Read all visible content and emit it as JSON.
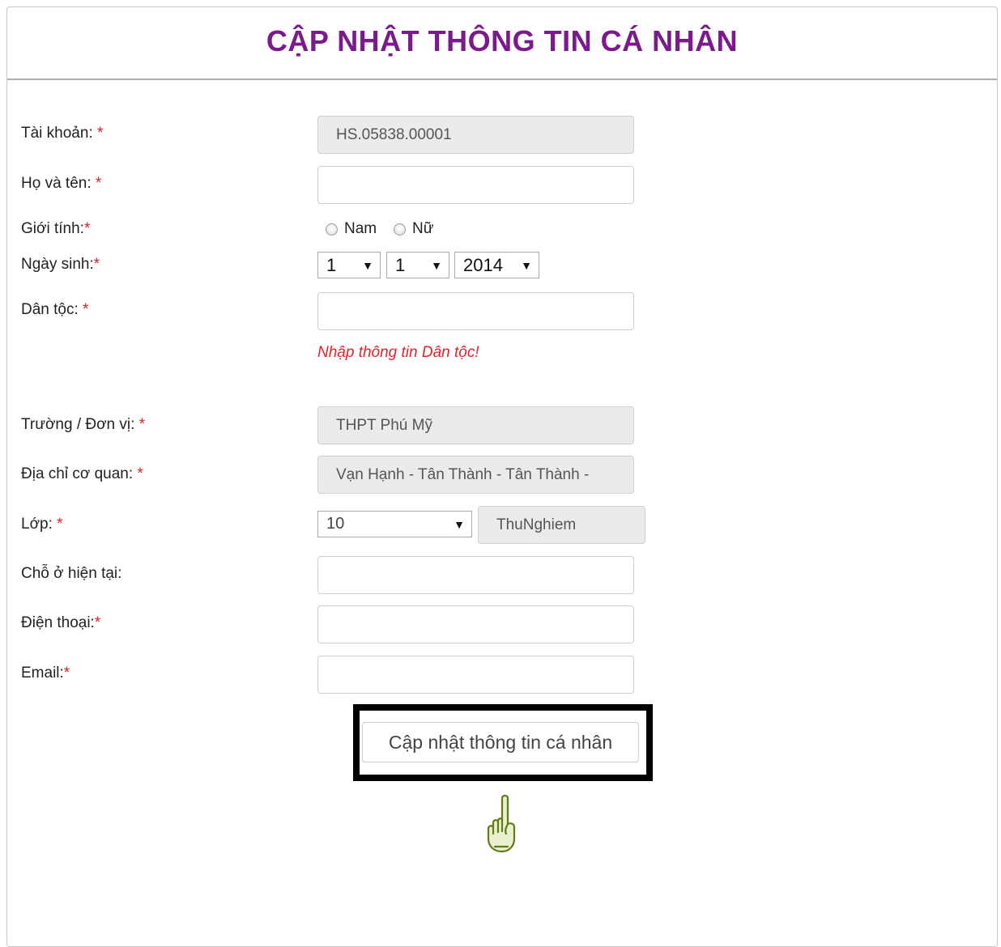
{
  "header": {
    "title": "CẬP NHẬT THÔNG TIN CÁ NHÂN"
  },
  "form": {
    "account": {
      "label": "Tài khoản: ",
      "required": "*",
      "value": "HS.05838.00001"
    },
    "full_name": {
      "label": "Họ và tên: ",
      "required": "*",
      "value": ""
    },
    "gender": {
      "label": "Giới tính:",
      "required": "*",
      "options": [
        "Nam",
        "Nữ"
      ]
    },
    "birth_date": {
      "label": "Ngày sinh:",
      "required": "*",
      "day": "1",
      "month": "1",
      "year": "2014"
    },
    "ethnicity": {
      "label": "Dân tộc: ",
      "required": "*",
      "value": "",
      "error": "Nhập thông tin Dân tộc!"
    },
    "school": {
      "label": "Trường / Đơn vị: ",
      "required": "*",
      "value": "THPT Phú Mỹ"
    },
    "office_address": {
      "label": "Địa chỉ cơ quan: ",
      "required": "*",
      "value": "Vạn Hạnh - Tân Thành - Tân Thành -"
    },
    "class": {
      "label": "Lớp: ",
      "required": "*",
      "grade": "10",
      "class_name": "ThuNghiem"
    },
    "current_residence": {
      "label": "Chỗ ở hiện tại:",
      "value": ""
    },
    "phone": {
      "label": "Điện thoại:",
      "required": "*",
      "value": ""
    },
    "email": {
      "label": "Email:",
      "required": "*",
      "value": ""
    }
  },
  "submit_label": "Cập nhật thông tin cá nhân",
  "colors": {
    "title": "#7a1a8c",
    "required": "#e02020",
    "error": "#e8202a",
    "hand_icon": "#6b8a1a"
  },
  "icons": {
    "pointer": "pointing-hand-icon"
  }
}
